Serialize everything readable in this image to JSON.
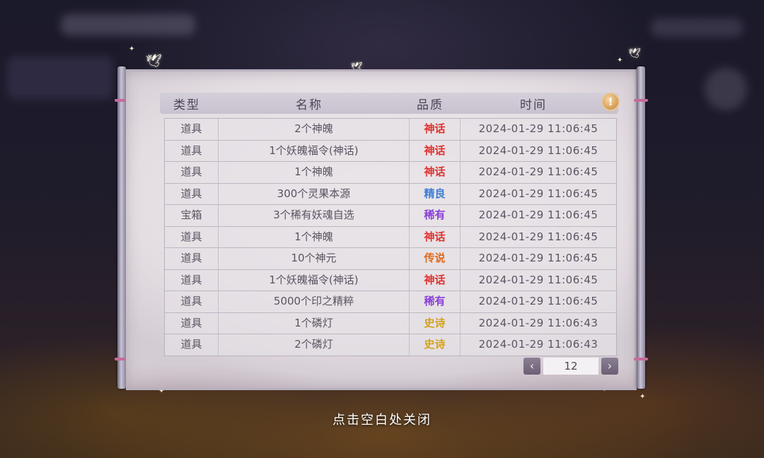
{
  "table": {
    "headers": {
      "type": "类型",
      "name": "名称",
      "quality": "品质",
      "time": "时间"
    },
    "rows": [
      {
        "type": "道具",
        "name": "2个神魄",
        "quality": "神话",
        "time": "2024-01-29  11:06:45"
      },
      {
        "type": "道具",
        "name": "1个妖魄福令(神话)",
        "quality": "神话",
        "time": "2024-01-29  11:06:45"
      },
      {
        "type": "道具",
        "name": "1个神魄",
        "quality": "神话",
        "time": "2024-01-29  11:06:45"
      },
      {
        "type": "道具",
        "name": "300个灵果本源",
        "quality": "精良",
        "time": "2024-01-29  11:06:45"
      },
      {
        "type": "宝箱",
        "name": "3个稀有妖魂自选",
        "quality": "稀有",
        "time": "2024-01-29  11:06:45"
      },
      {
        "type": "道具",
        "name": "1个神魄",
        "quality": "神话",
        "time": "2024-01-29  11:06:45"
      },
      {
        "type": "道具",
        "name": "10个神元",
        "quality": "传说",
        "time": "2024-01-29  11:06:45"
      },
      {
        "type": "道具",
        "name": "1个妖魄福令(神话)",
        "quality": "神话",
        "time": "2024-01-29  11:06:45"
      },
      {
        "type": "道具",
        "name": "5000个印之精粹",
        "quality": "稀有",
        "time": "2024-01-29  11:06:45"
      },
      {
        "type": "道具",
        "name": "1个磷灯",
        "quality": "史诗",
        "time": "2024-01-29  11:06:43"
      },
      {
        "type": "道具",
        "name": "2个磷灯",
        "quality": "史诗",
        "time": "2024-01-29  11:06:43"
      }
    ]
  },
  "quality_colors": {
    "神话": "#e0322e",
    "精良": "#3d7fd6",
    "稀有": "#8a3fd8",
    "传说": "#e06a1e",
    "史诗": "#d4a21a"
  },
  "info_button": {
    "icon": "exclamation-icon",
    "glyph": "!"
  },
  "pager": {
    "prev_icon": "chevron-left-icon",
    "prev_glyph": "‹",
    "page": "12",
    "next_icon": "chevron-right-icon",
    "next_glyph": "›"
  },
  "close_hint": "点击空白处关闭"
}
